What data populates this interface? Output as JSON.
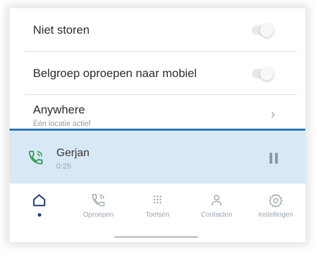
{
  "settings": {
    "dnd_label": "Niet storen",
    "dnd_on": false,
    "ringgroup_label": "Belgroep oproepen naar mobiel",
    "ringgroup_on": false,
    "anywhere_label": "Anywhere",
    "anywhere_sub": "Één locatie actief"
  },
  "call": {
    "name": "Gerjan",
    "duration": "0:25"
  },
  "nav": {
    "items": [
      {
        "label": "",
        "icon": "home-icon",
        "active": true
      },
      {
        "label": "Oproepen",
        "icon": "phone-calls-icon"
      },
      {
        "label": "Toetsen",
        "icon": "keypad-icon"
      },
      {
        "label": "Contacten",
        "icon": "person-icon"
      },
      {
        "label": "Instellingen",
        "icon": "gear-icon"
      }
    ]
  },
  "colors": {
    "accent": "#2a73b8",
    "call_bar_bg": "#d9e8f5",
    "call_icon": "#2e9d4f",
    "nav_active": "#1d3a6a"
  }
}
